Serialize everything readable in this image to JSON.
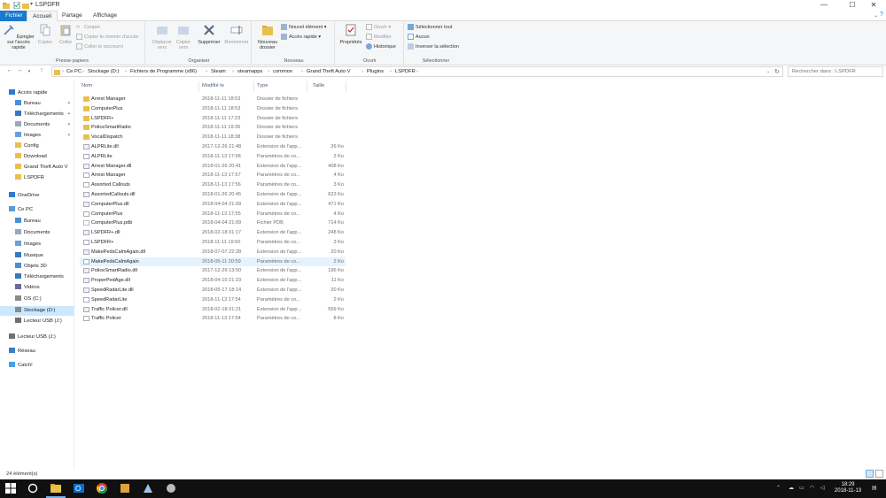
{
  "window": {
    "title": "LSPDFR",
    "controls": {
      "minimize": "—",
      "maximize": "☐",
      "close": "✕"
    }
  },
  "tabs": [
    {
      "label": "Fichier",
      "kind": "file"
    },
    {
      "label": "Accueil",
      "kind": "active"
    },
    {
      "label": "Partage",
      "kind": ""
    },
    {
      "label": "Affichage",
      "kind": ""
    }
  ],
  "ribbon": {
    "clipboard": {
      "label": "Presse-papiers",
      "pin": "Épingler sur l'accès rapide",
      "copy": "Copier",
      "paste": "Coller",
      "cut": "Couper",
      "copy_path": "Copier le chemin d'accès",
      "paste_shortcut": "Coller le raccourci"
    },
    "organize": {
      "label": "Organiser",
      "move": "Déplacer vers",
      "copy_to": "Copier vers",
      "delete": "Supprimer",
      "rename": "Renommer"
    },
    "new": {
      "label": "Nouveau",
      "new_folder": "Nouveau dossier",
      "new_item": "Nouvel élément",
      "easy_access": "Accès rapide"
    },
    "open": {
      "label": "Ouvrir",
      "properties": "Propriétés",
      "open": "Ouvrir",
      "edit": "Modifier",
      "history": "Historique"
    },
    "select": {
      "label": "Sélectionner",
      "select_all": "Sélectionner tout",
      "select_none": "Aucun",
      "invert": "Inverser la sélection"
    }
  },
  "address": {
    "breadcrumbs": [
      "Ce PC",
      "Stockage (D:)",
      "Fichiers de Programme (x86)",
      "Steam",
      "steamapps",
      "common",
      "Grand Theft Auto V",
      "Plugins",
      "LSPDFR"
    ],
    "search_placeholder": "Rechercher dans : LSPDFR"
  },
  "sidebar": {
    "items": [
      {
        "label": "Accès rapide",
        "icon": "star-icon",
        "indent": 0,
        "pinned": false,
        "selected": false
      },
      {
        "label": "Bureau",
        "icon": "desktop-icon",
        "indent": 1,
        "pinned": true,
        "selected": false
      },
      {
        "label": "Téléchargements",
        "icon": "download-icon",
        "indent": 1,
        "pinned": true,
        "selected": false
      },
      {
        "label": "Documents",
        "icon": "document-icon",
        "indent": 1,
        "pinned": true,
        "selected": false
      },
      {
        "label": "Images",
        "icon": "image-icon",
        "indent": 1,
        "pinned": true,
        "selected": false
      },
      {
        "label": "Config",
        "icon": "folder-icon",
        "indent": 1,
        "pinned": false,
        "selected": false
      },
      {
        "label": "Download",
        "icon": "folder-icon",
        "indent": 1,
        "pinned": false,
        "selected": false
      },
      {
        "label": "Grand Theft Auto V",
        "icon": "folder-icon",
        "indent": 1,
        "pinned": false,
        "selected": false
      },
      {
        "label": "LSPDFR",
        "icon": "folder-icon",
        "indent": 1,
        "pinned": false,
        "selected": false
      },
      {
        "label": "OneDrive",
        "icon": "cloud-icon",
        "indent": 0,
        "pinned": false,
        "selected": false
      },
      {
        "label": "Ce PC",
        "icon": "computer-icon",
        "indent": 0,
        "pinned": false,
        "selected": false
      },
      {
        "label": "Bureau",
        "icon": "desktop-icon",
        "indent": 1,
        "pinned": false,
        "selected": false
      },
      {
        "label": "Documents",
        "icon": "document-icon",
        "indent": 1,
        "pinned": false,
        "selected": false
      },
      {
        "label": "Images",
        "icon": "image-icon",
        "indent": 1,
        "pinned": false,
        "selected": false
      },
      {
        "label": "Musique",
        "icon": "music-icon",
        "indent": 1,
        "pinned": false,
        "selected": false
      },
      {
        "label": "Objets 3D",
        "icon": "cube-icon",
        "indent": 1,
        "pinned": false,
        "selected": false
      },
      {
        "label": "Téléchargements",
        "icon": "download-icon",
        "indent": 1,
        "pinned": false,
        "selected": false
      },
      {
        "label": "Vidéos",
        "icon": "video-icon",
        "indent": 1,
        "pinned": false,
        "selected": false
      },
      {
        "label": "OS (C:)",
        "icon": "drive-icon",
        "indent": 1,
        "pinned": false,
        "selected": false
      },
      {
        "label": "Stockage (D:)",
        "icon": "drive-icon",
        "indent": 1,
        "pinned": false,
        "selected": true
      },
      {
        "label": "Lecteur USB (J:)",
        "icon": "usb-drive-icon",
        "indent": 1,
        "pinned": false,
        "selected": false
      },
      {
        "label": "Lecteur USB (J:)",
        "icon": "usb-drive-icon",
        "indent": 0,
        "pinned": false,
        "selected": false
      },
      {
        "label": "Réseau",
        "icon": "network-icon",
        "indent": 0,
        "pinned": false,
        "selected": false
      },
      {
        "label": "Catch!",
        "icon": "catch-icon",
        "indent": 0,
        "pinned": false,
        "selected": false
      }
    ]
  },
  "columns": {
    "name": "Nom",
    "date": "Modifié le",
    "type": "Type",
    "size": "Taille"
  },
  "files": [
    {
      "name": "Arrest Manager",
      "date": "2018-11-11 18:53",
      "type": "Dossier de fichiers",
      "size": "",
      "icon": "folder-icon"
    },
    {
      "name": "ComputerPlus",
      "date": "2018-11-11 18:53",
      "type": "Dossier de fichiers",
      "size": "",
      "icon": "folder-icon"
    },
    {
      "name": "LSPDFR+",
      "date": "2018-11-11 17:23",
      "type": "Dossier de fichiers",
      "size": "",
      "icon": "folder-icon"
    },
    {
      "name": "PoliceSmartRadio",
      "date": "2018-11-11 19:36",
      "type": "Dossier de fichiers",
      "size": "",
      "icon": "folder-icon"
    },
    {
      "name": "VocalDispatch",
      "date": "2018-11-11 18:38",
      "type": "Dossier de fichiers",
      "size": "",
      "icon": "folder-icon"
    },
    {
      "name": "ALPRLite.dll",
      "date": "2017-12-26 21:48",
      "type": "Extension de l'app...",
      "size": "26 Ko",
      "icon": "dll-icon"
    },
    {
      "name": "ALPRLite",
      "date": "2018-11-13 17:58",
      "type": "Paramètres de co...",
      "size": "2 Ko",
      "icon": "settings-file-icon"
    },
    {
      "name": "Arrest Manager.dll",
      "date": "2018-01-26 20:41",
      "type": "Extension de l'app...",
      "size": "408 Ko",
      "icon": "dll-icon"
    },
    {
      "name": "Arrest Manager",
      "date": "2018-11-13 17:57",
      "type": "Paramètres de co...",
      "size": "4 Ko",
      "icon": "settings-file-icon"
    },
    {
      "name": "Assorted Callouts",
      "date": "2018-11-13 17:56",
      "type": "Paramètres de co...",
      "size": "3 Ko",
      "icon": "settings-file-icon"
    },
    {
      "name": "AssortedCallouts.dll",
      "date": "2018-01-26 20:45",
      "type": "Extension de l'app...",
      "size": "623 Ko",
      "icon": "dll-icon"
    },
    {
      "name": "ComputerPlus.dll",
      "date": "2018-04-04 21:09",
      "type": "Extension de l'app...",
      "size": "471 Ko",
      "icon": "dll-icon"
    },
    {
      "name": "ComputerPlus",
      "date": "2018-11-13 17:55",
      "type": "Paramètres de co...",
      "size": "4 Ko",
      "icon": "settings-file-icon"
    },
    {
      "name": "ComputerPlus.pdb",
      "date": "2018-04-04 21:09",
      "type": "Fichier PDB",
      "size": "714 Ko",
      "icon": "file-icon"
    },
    {
      "name": "LSPDFR+.dll",
      "date": "2018-02-18 01:17",
      "type": "Extension de l'app...",
      "size": "248 Ko",
      "icon": "dll-icon"
    },
    {
      "name": "LSPDFR+",
      "date": "2018-11-11 19:50",
      "type": "Paramètres de co...",
      "size": "3 Ko",
      "icon": "settings-file-icon"
    },
    {
      "name": "MakePedsCalmAgain.dll",
      "date": "2018-07-07 22:28",
      "type": "Extension de l'app...",
      "size": "20 Ko",
      "icon": "dll-icon"
    },
    {
      "name": "MakePedsCalmAgain",
      "date": "2018-05-11 20:59",
      "type": "Paramètres de co...",
      "size": "2 Ko",
      "icon": "settings-file-icon",
      "selected": true
    },
    {
      "name": "PoliceSmartRadio.dll",
      "date": "2017-12-29 13:50",
      "type": "Extension de l'app...",
      "size": "196 Ko",
      "icon": "dll-icon"
    },
    {
      "name": "ProperPedAge.dll",
      "date": "2018-04-10 21:23",
      "type": "Extension de l'app...",
      "size": "11 Ko",
      "icon": "dll-icon"
    },
    {
      "name": "SpeedRadarLite.dll",
      "date": "2018-05-17 18:14",
      "type": "Extension de l'app...",
      "size": "20 Ko",
      "icon": "dll-icon"
    },
    {
      "name": "SpeedRadarLite",
      "date": "2018-11-13 17:54",
      "type": "Paramètres de co...",
      "size": "2 Ko",
      "icon": "settings-file-icon"
    },
    {
      "name": "Traffic Policer.dll",
      "date": "2018-02-18 01:21",
      "type": "Extension de l'app...",
      "size": "559 Ko",
      "icon": "dll-icon"
    },
    {
      "name": "Traffic Policer",
      "date": "2018-11-13 17:54",
      "type": "Paramètres de co...",
      "size": "8 Ko",
      "icon": "settings-file-icon"
    }
  ],
  "status": {
    "count": "24 élément(s)"
  },
  "taskbar": {
    "clock_time": "18:29",
    "clock_date": "2018-11-13",
    "apps": [
      "windows-start-icon",
      "search-icon",
      "file-explorer-icon",
      "outlook-icon",
      "chrome-icon",
      "app-icon",
      "app-icon-2",
      "app-icon-3"
    ]
  },
  "colors": {
    "accent": "#1979ca",
    "folder": "#e8c04d",
    "selection": "#cce8ff",
    "row_selected": "#e5f3ff",
    "taskbar": "#101010"
  }
}
